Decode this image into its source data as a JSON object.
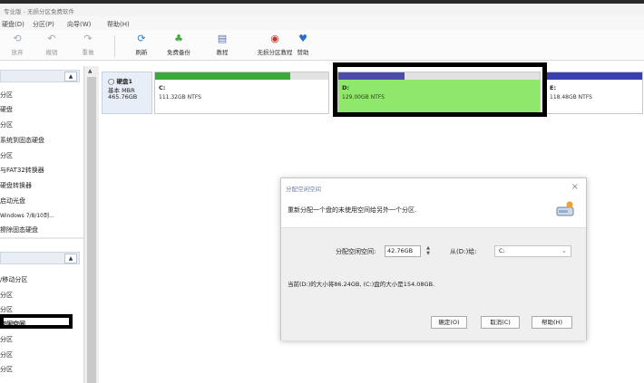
{
  "window": {
    "title": "专业版 - 无损分区免费软件"
  },
  "menu": [
    "硬盘(D)",
    "分区(P)",
    "向导(W)",
    "帮助(H)"
  ],
  "toolbar": {
    "items": [
      {
        "label": "放弃",
        "icon": "discard-icon",
        "enabled": false
      },
      {
        "label": "撤销",
        "icon": "undo-icon",
        "enabled": false
      },
      {
        "label": "重做",
        "icon": "redo-icon",
        "enabled": false
      },
      {
        "label": "刷新",
        "icon": "refresh-icon",
        "enabled": true
      },
      {
        "label": "免费备份",
        "icon": "backup-icon",
        "enabled": true
      },
      {
        "label": "教程",
        "icon": "tutorial-icon",
        "enabled": true
      },
      {
        "label": "无损分区教程",
        "icon": "partition-tutorial-icon",
        "enabled": true
      },
      {
        "label": "赞助",
        "icon": "sponsor-icon",
        "enabled": true
      }
    ]
  },
  "sidebar": {
    "group1": [
      "分区",
      "硬盘",
      "分区",
      "系统到固态硬盘",
      "分区",
      "与FAT32转换器",
      "硬盘转换器",
      "启动光盘",
      "Windows 7/8/10到...",
      "擦除固态硬盘"
    ],
    "group2": [
      "/移动分区",
      "分区",
      "分区",
      "空闲空间",
      "分区",
      "分区",
      "分区"
    ]
  },
  "disk": {
    "name": "硬盘1",
    "type": "基本 MBR",
    "size": "465.76GB",
    "partitions": [
      {
        "name": "C:",
        "info": "111.32GB NTFS",
        "used": 0.78,
        "color": "#3aa83a"
      },
      {
        "name": "D:",
        "info": "129.00GB NTFS",
        "used": 0.33,
        "color": "#4b4baa"
      },
      {
        "name": "E:",
        "info": "118.48GB NTFS",
        "used": 1.0,
        "color": "#3a3fb0"
      }
    ]
  },
  "dialog": {
    "title": "分配空闲空间",
    "description": "重新分配一个盘的未使用空间给另外一个分区.",
    "size_label": "分配空闲空间:",
    "size_value": "42.76GB",
    "from_label": "从(D:)给:",
    "target_value": "C:",
    "summary": "当前(D:)的大小将86.24GB, (C:)盘的大小是154.08GB.",
    "buttons": {
      "ok": "确定(O)",
      "cancel": "取消(C)",
      "help": "帮助(H)"
    }
  }
}
